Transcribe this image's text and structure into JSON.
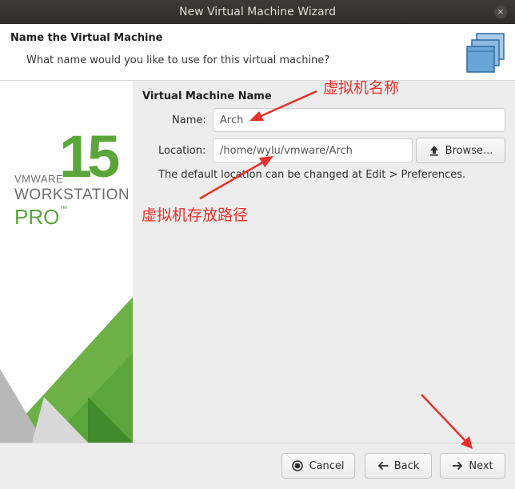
{
  "window": {
    "title": "New Virtual Machine Wizard",
    "close_glyph": "×"
  },
  "header": {
    "title": "Name the Virtual Machine",
    "subtitle": "What name would you like to use for this virtual machine?",
    "icon": "virtual-machines-icon"
  },
  "brand": {
    "version": "15",
    "vendor": "VMWARE",
    "product": "WORKSTATION",
    "edition": "PRO",
    "trademark": "™",
    "accent_color": "#5aa63b"
  },
  "form": {
    "section_title": "Virtual Machine Name",
    "name_label": "Name:",
    "name_value": "Arch",
    "location_label": "Location:",
    "location_value": "/home/wylu/vmware/Arch",
    "browse_label": "Browse...",
    "browse_icon": "upload-arrow-icon",
    "hint": "The default location can be changed at Edit > Preferences."
  },
  "footer": {
    "cancel_label": "Cancel",
    "back_label": "Back",
    "next_label": "Next"
  },
  "annotations": {
    "name_note": "虚拟机名称",
    "path_note": "虚拟机存放路径",
    "color": "#e8312a"
  }
}
